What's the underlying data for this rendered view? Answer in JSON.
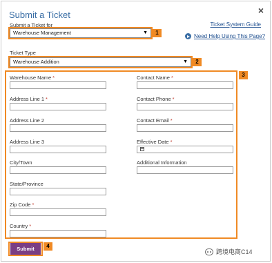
{
  "dialog": {
    "title": "Submit a Ticket",
    "close_glyph": "×",
    "ticket_system_guide": "Ticket System Guide",
    "help_link": "Need Help Using This Page?"
  },
  "ticket_for": {
    "label": "Submit a Ticket for",
    "selected": "Warehouse Management",
    "badge": "1"
  },
  "ticket_type": {
    "label": "Ticket Type",
    "selected": "Warehouse Addition",
    "badge": "2"
  },
  "form": {
    "badge": "3",
    "left_fields": [
      {
        "label": "Warehouse Name",
        "required": true
      },
      {
        "label": "Address Line 1",
        "required": true
      },
      {
        "label": "Address Line 2",
        "required": false
      },
      {
        "label": "Address Line 3",
        "required": false
      },
      {
        "label": "City/Town",
        "required": false
      },
      {
        "label": "State/Province",
        "required": false
      },
      {
        "label": "Zip Code",
        "required": true
      },
      {
        "label": "Country",
        "required": true
      }
    ],
    "right_fields": [
      {
        "label": "Contact Name",
        "required": true
      },
      {
        "label": "Contact Phone",
        "required": true
      },
      {
        "label": "Contact Email",
        "required": true
      },
      {
        "label": "Effective Date",
        "required": true
      },
      {
        "label": "Additional Information",
        "required": false
      }
    ],
    "required_mark": "*"
  },
  "submit": {
    "label": "Submit",
    "badge": "4"
  },
  "watermark": {
    "text": "跨境电商C14"
  },
  "colors": {
    "highlight": "#f08a24",
    "title": "#3a6ea5",
    "submit_bg": "#7a3e84",
    "required": "#c0392b"
  }
}
